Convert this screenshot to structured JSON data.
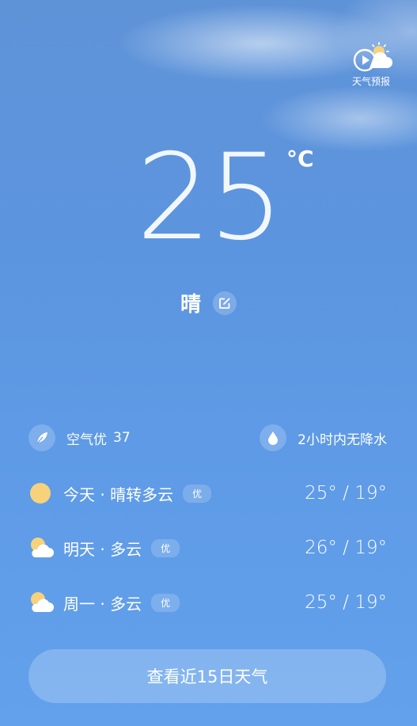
{
  "forecast_entry": {
    "label": "天气预报",
    "icon": "weather-video-icon"
  },
  "current": {
    "temperature": "25",
    "unit": "°C",
    "condition": "晴"
  },
  "info": {
    "air": {
      "label": "空气优",
      "value": "37",
      "icon": "leaf-icon"
    },
    "rain": {
      "label": "2小时内无降水",
      "icon": "water-drop-icon"
    }
  },
  "days": [
    {
      "name": "今天 · 晴转多云",
      "quality": "优",
      "range": "25° / 19°",
      "icon": "sunny-icon"
    },
    {
      "name": "明天 · 多云",
      "quality": "优",
      "range": "26° / 19°",
      "icon": "partly-cloudy-icon"
    },
    {
      "name": "周一 · 多云",
      "quality": "优",
      "range": "25° / 19°",
      "icon": "partly-cloudy-icon"
    }
  ],
  "button": {
    "label": "查看近15日天气"
  },
  "colors": {
    "sky_top": "#5f93d8",
    "sky_bottom": "#63a1ec",
    "sun": "#f7d27b"
  }
}
